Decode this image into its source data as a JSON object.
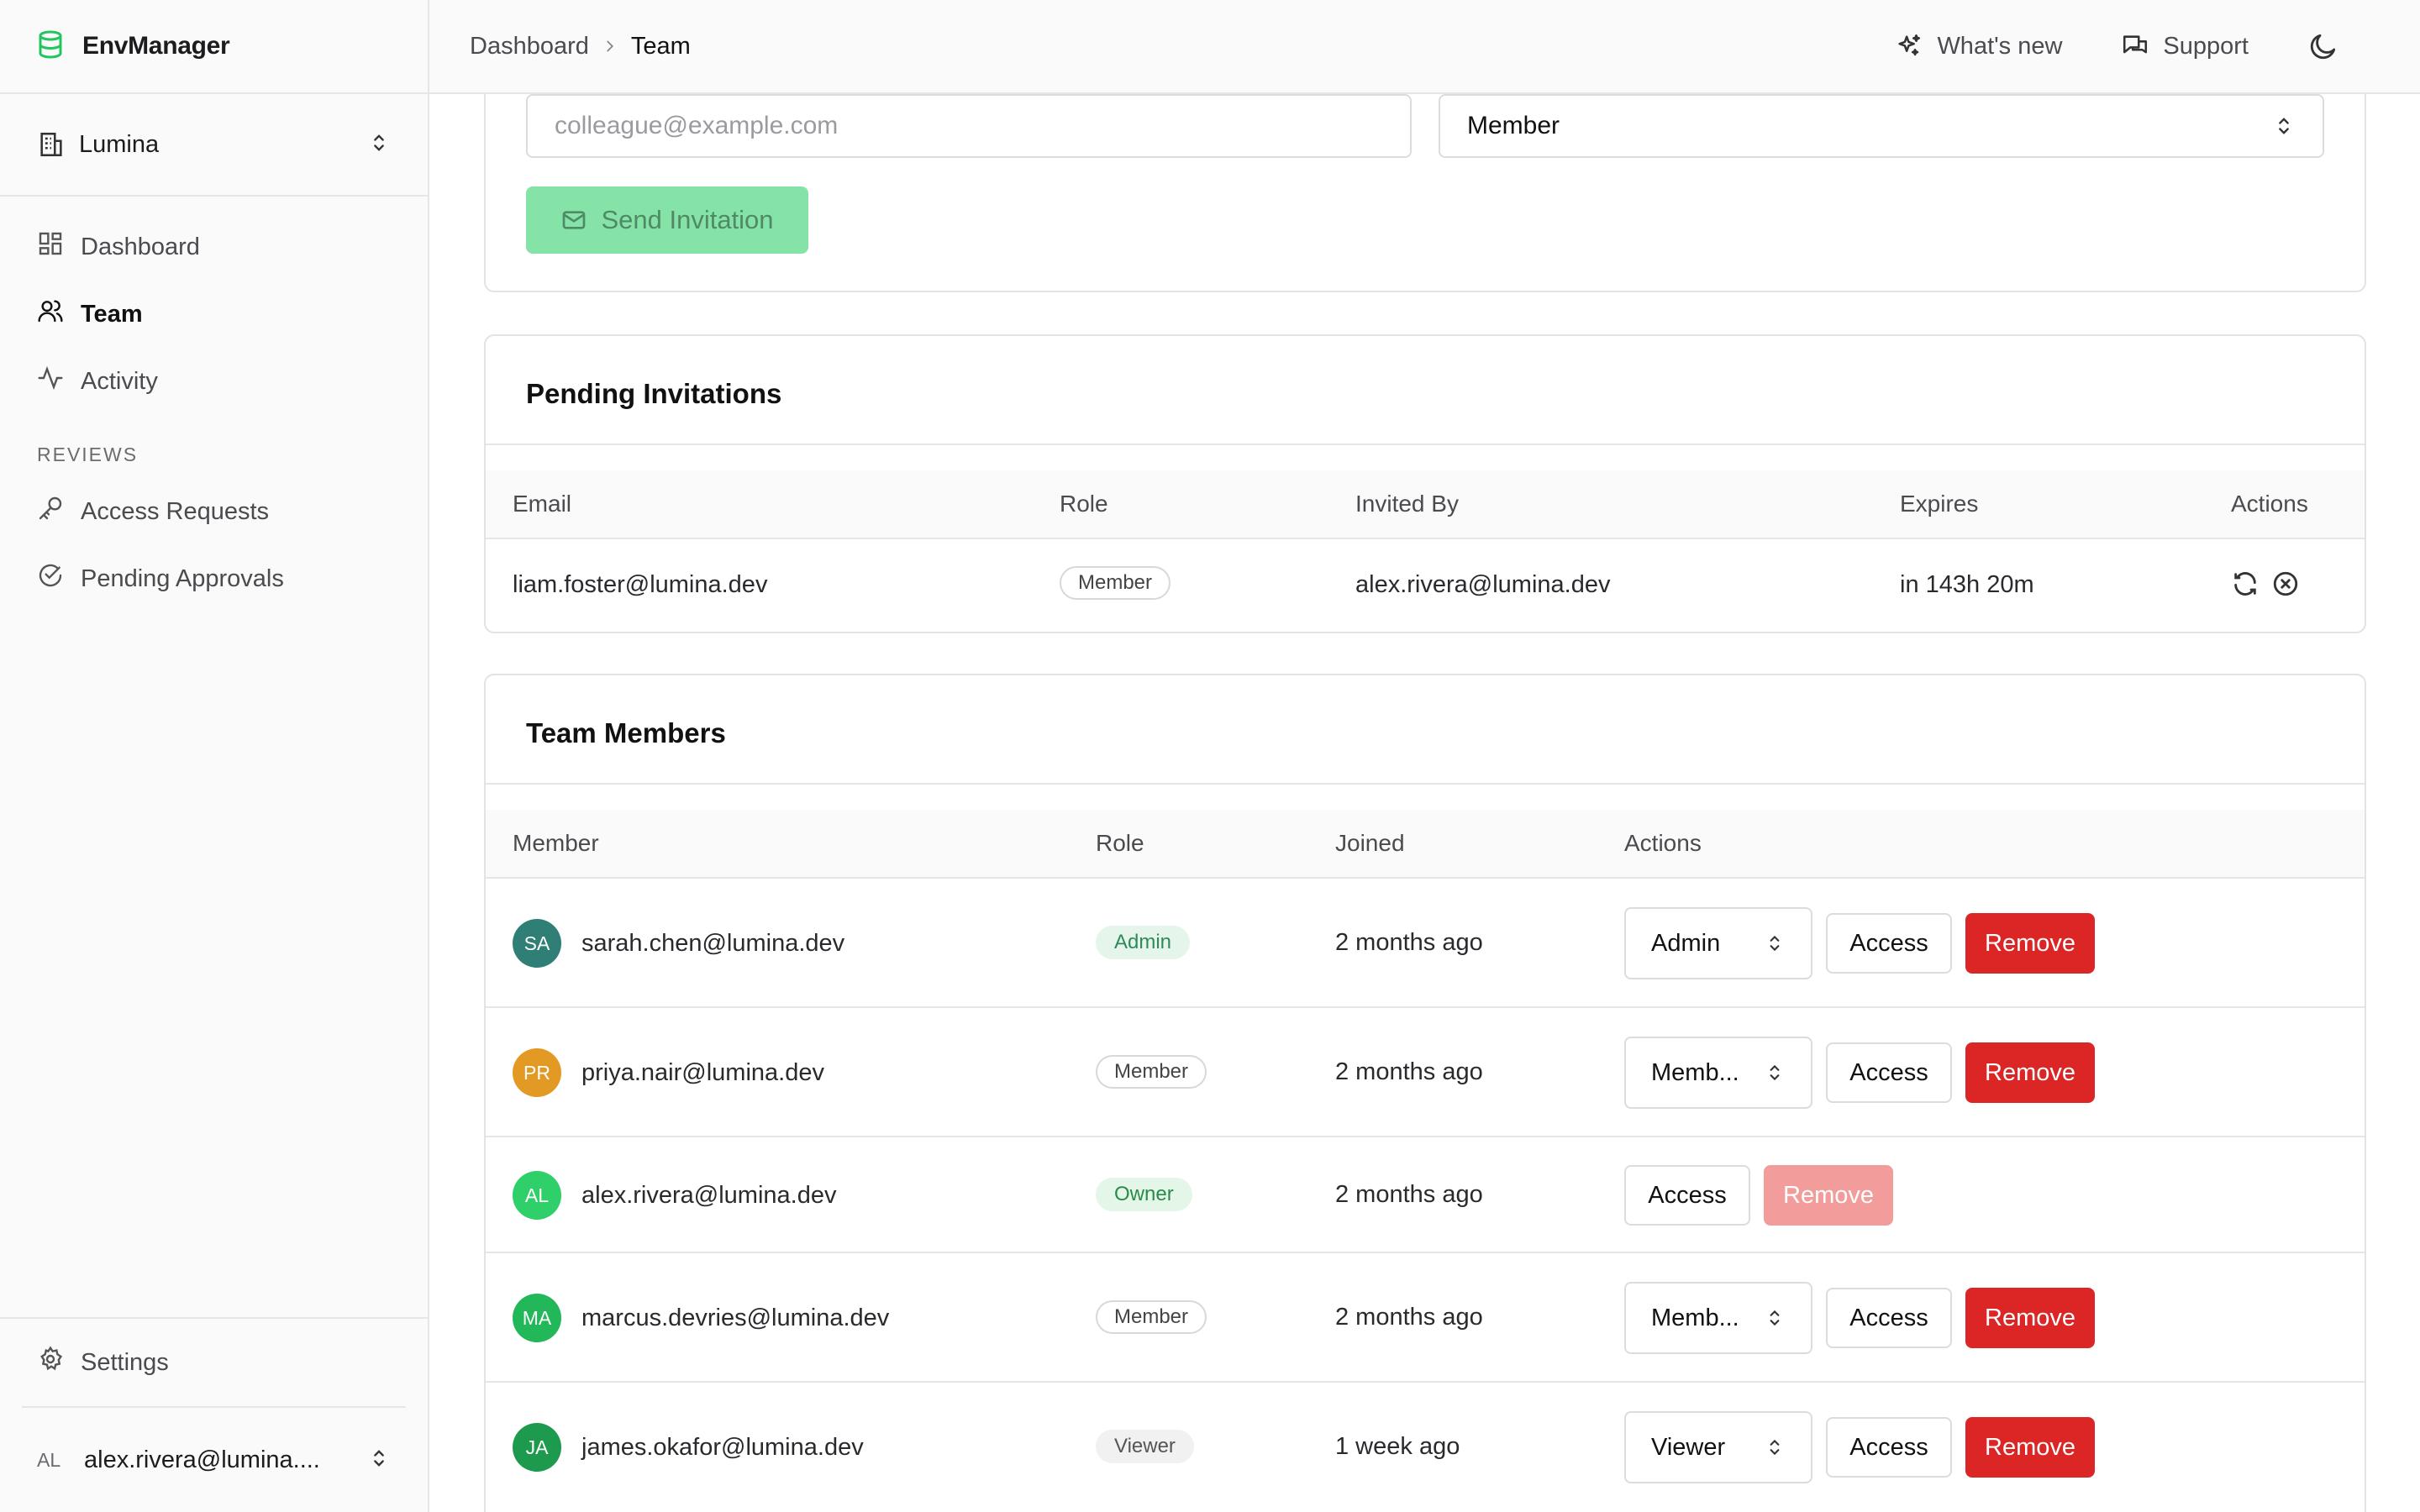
{
  "app": {
    "name": "EnvManager",
    "accent": "#22c55e"
  },
  "org": {
    "name": "Lumina"
  },
  "nav": {
    "items": [
      {
        "label": "Dashboard",
        "icon": "dashboard-icon"
      },
      {
        "label": "Team",
        "icon": "users-icon",
        "active": true
      },
      {
        "label": "Activity",
        "icon": "activity-icon"
      }
    ],
    "section_reviews": "REVIEWS",
    "review_items": [
      {
        "label": "Access Requests",
        "icon": "key-icon"
      },
      {
        "label": "Pending Approvals",
        "icon": "check-circle-icon"
      }
    ],
    "settings": "Settings"
  },
  "user": {
    "initials": "AL",
    "email": "alex.rivera@lumina...."
  },
  "breadcrumb": {
    "root": "Dashboard",
    "current": "Team"
  },
  "topbar": {
    "whats_new": "What's new",
    "support": "Support"
  },
  "invite": {
    "email_placeholder": "colleague@example.com",
    "role_value": "Member",
    "send_label": "Send Invitation"
  },
  "pending": {
    "title": "Pending Invitations",
    "columns": [
      "Email",
      "Role",
      "Invited By",
      "Expires",
      "Actions"
    ],
    "rows": [
      {
        "email": "liam.foster@lumina.dev",
        "role": "Member",
        "invited_by": "alex.rivera@lumina.dev",
        "expires": "in 143h 20m"
      }
    ]
  },
  "members": {
    "title": "Team Members",
    "columns": [
      "Member",
      "Role",
      "Joined",
      "Actions"
    ],
    "access_label": "Access",
    "remove_label": "Remove",
    "rows": [
      {
        "initials": "SA",
        "avatar_color": "#2f7f76",
        "email": "sarah.chen@lumina.dev",
        "role": "Admin",
        "role_style": "admin",
        "joined": "2 months ago",
        "select": "Admin"
      },
      {
        "initials": "PR",
        "avatar_color": "#e39a24",
        "email": "priya.nair@lumina.dev",
        "role": "Member",
        "role_style": "member",
        "joined": "2 months ago",
        "select": "Memb..."
      },
      {
        "initials": "AL",
        "avatar_color": "#2fcf6a",
        "email": "alex.rivera@lumina.dev",
        "role": "Owner",
        "role_style": "owner",
        "joined": "2 months ago",
        "select": null
      },
      {
        "initials": "MA",
        "avatar_color": "#22b85a",
        "email": "marcus.devries@lumina.dev",
        "role": "Member",
        "role_style": "member",
        "joined": "2 months ago",
        "select": "Memb..."
      },
      {
        "initials": "JA",
        "avatar_color": "#1e9a4e",
        "email": "james.okafor@lumina.dev",
        "role": "Viewer",
        "role_style": "viewer",
        "joined": "1 week ago",
        "select": "Viewer"
      }
    ]
  }
}
